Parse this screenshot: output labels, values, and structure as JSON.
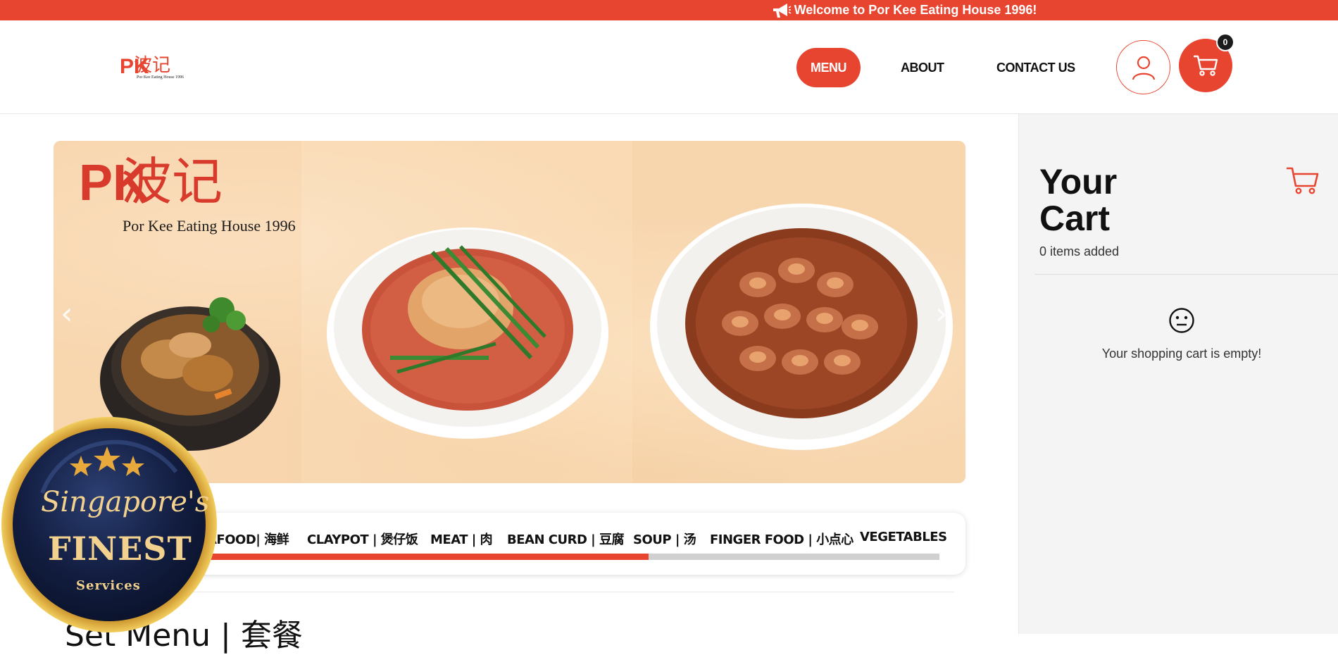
{
  "announcement": {
    "text": "Welcome to Por Kee Eating House 1996!",
    "icon": "megaphone-icon"
  },
  "header": {
    "logo": {
      "mark": "PK",
      "chinese": "波记",
      "tagline": "Por Kee Eating House 1996"
    },
    "nav": [
      {
        "label": "MENU",
        "active": true
      },
      {
        "label": "ABOUT",
        "active": false
      },
      {
        "label": "CONTACT US",
        "active": false
      }
    ],
    "cart_count": "0",
    "icons": [
      "user-icon",
      "cart-icon"
    ]
  },
  "hero": {
    "logo": {
      "mark": "PK",
      "chinese": "波记",
      "tagline": "Por Kee Eating House 1996"
    },
    "prev_arrow": "‹",
    "next_arrow": "›"
  },
  "categories": {
    "items": [
      "AFOOD| 海鲜",
      "CLAYPOT | 煲仔饭",
      "MEAT | 肉",
      "BEAN CURD | 豆腐",
      "SOUP | 汤",
      "FINGER FOOD | 小点心",
      "VEGETABLES"
    ],
    "scroll_progress": 0.62
  },
  "section": {
    "title": "Set Menu | 套餐"
  },
  "cart": {
    "title_line1": "Your",
    "title_line2": "Cart",
    "items_added": "0 items added",
    "empty_message": "Your shopping cart is empty!",
    "empty_icon": "neutral-face-icon"
  },
  "badge": {
    "script": "Singapore's",
    "finest": "FINEST",
    "services": "Services"
  },
  "colors": {
    "accent": "#e84530",
    "dark": "#1c1c1c",
    "sidebar_bg": "#f4f4f4"
  }
}
